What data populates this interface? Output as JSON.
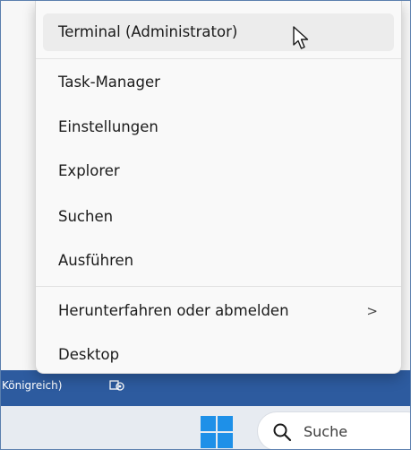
{
  "menu": {
    "items": [
      {
        "label": "Terminal (Administrator)"
      },
      {
        "label": "Task-Manager"
      },
      {
        "label": "Einstellungen"
      },
      {
        "label": "Explorer"
      },
      {
        "label": "Suchen"
      },
      {
        "label": "Ausführen"
      },
      {
        "label": "Herunterfahren oder abmelden",
        "submenu_glyph": ">"
      },
      {
        "label": "Desktop"
      }
    ],
    "hovered_item": "Terminal (Administrator)"
  },
  "background_window": {
    "status_text": "Königreich)"
  },
  "taskbar": {
    "search_label": "Suche",
    "search_icon": "search-icon",
    "start_icon": "windows-logo-icon"
  },
  "colors": {
    "status_strip": "#2d5b9f",
    "windows_logo": "#1e90e8",
    "menu_background": "#f9f9f9",
    "hover_background": "#ececec"
  }
}
